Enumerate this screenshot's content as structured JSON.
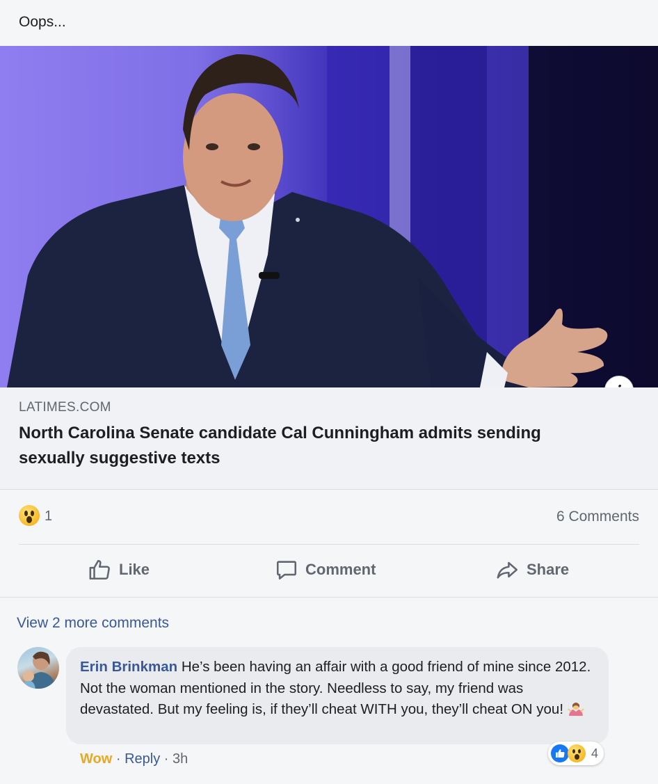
{
  "post": {
    "text": "Oops..."
  },
  "link": {
    "domain": "LATIMES.COM",
    "headline": "North Carolina Senate candidate Cal Cunningham admits sending sexually suggestive texts",
    "info_glyph": "i"
  },
  "stats": {
    "reaction_count": "1",
    "comments_count": "6 Comments"
  },
  "actions": {
    "like": "Like",
    "comment": "Comment",
    "share": "Share"
  },
  "comments": {
    "view_more": "View 2 more comments",
    "items": [
      {
        "author": "Erin Brinkman",
        "text": "He’s been having an affair with a good friend of mine since 2012. Not the woman mentioned in the story. Needless to say, my friend was devastated. But my feeling is, if they’ll cheat WITH you, they’ll cheat ON you!",
        "reaction_count": "4",
        "wow": "Wow",
        "sep1": "·",
        "reply": "Reply",
        "sep2": "·",
        "time": "3h"
      }
    ]
  },
  "colors": {
    "link_blue": "#385898",
    "like_blue": "#1877f2",
    "wow_yellow": "#f7b928",
    "meta_gray": "#606770"
  }
}
